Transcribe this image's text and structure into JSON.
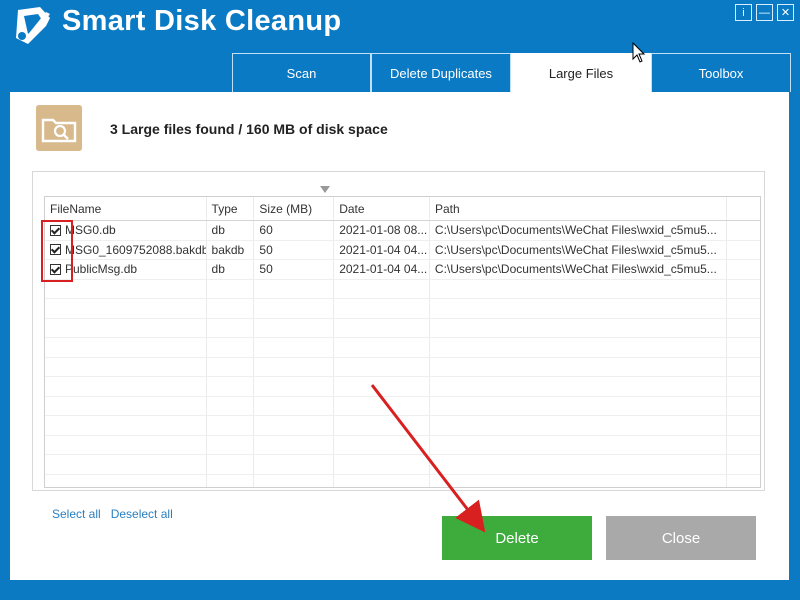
{
  "app": {
    "title": "Smart Disk Cleanup"
  },
  "window_controls": {
    "info": "i",
    "minimize": "—",
    "close": "✕"
  },
  "tabs": [
    {
      "label": "Scan",
      "active": false
    },
    {
      "label": "Delete Duplicates",
      "active": false
    },
    {
      "label": "Large Files",
      "active": true
    },
    {
      "label": "Toolbox",
      "active": false
    }
  ],
  "summary": "3 Large files found / 160 MB of disk space",
  "table": {
    "columns": [
      "FileName",
      "Type",
      "Size (MB)",
      "Date",
      "Path"
    ],
    "rows": [
      {
        "checked": true,
        "name": "MSG0.db",
        "type": "db",
        "size": "60",
        "date": "2021-01-08 08...",
        "path": "C:\\Users\\pc\\Documents\\WeChat Files\\wxid_c5mu5..."
      },
      {
        "checked": true,
        "name": "MSG0_1609752088.bakdb",
        "type": "bakdb",
        "size": "50",
        "date": "2021-01-04 04...",
        "path": "C:\\Users\\pc\\Documents\\WeChat Files\\wxid_c5mu5..."
      },
      {
        "checked": true,
        "name": "PublicMsg.db",
        "type": "db",
        "size": "50",
        "date": "2021-01-04 04...",
        "path": "C:\\Users\\pc\\Documents\\WeChat Files\\wxid_c5mu5..."
      }
    ]
  },
  "links": {
    "select_all": "Select all",
    "deselect_all": "Deselect all"
  },
  "buttons": {
    "delete": "Delete",
    "close": "Close"
  },
  "colors": {
    "header": "#0b7ac4",
    "delete": "#3eab3d",
    "close": "#a9a9a9",
    "highlight": "#d92020",
    "link": "#2a7fc0"
  }
}
